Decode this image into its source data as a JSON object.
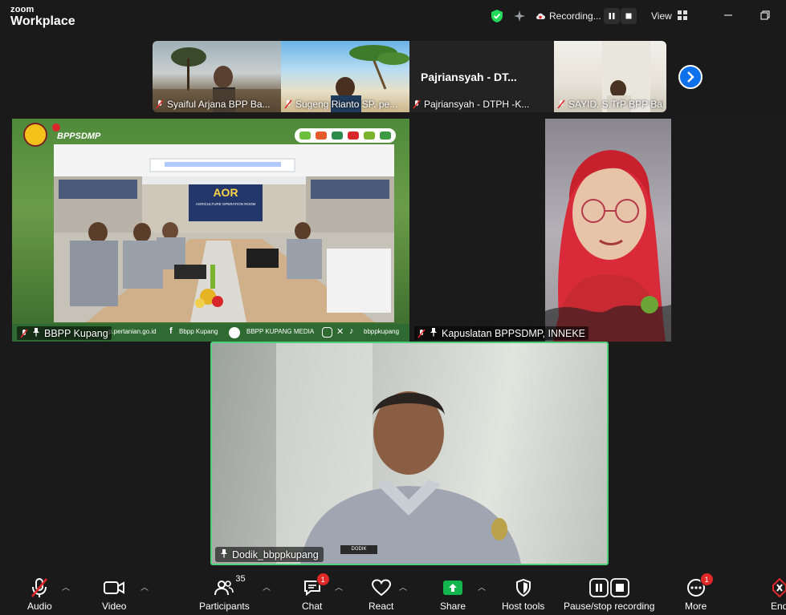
{
  "app": {
    "brand_small": "zoom",
    "brand_big": "Workplace"
  },
  "titlebar": {
    "recording_label": "Recording...",
    "view_label": "View"
  },
  "strip": [
    {
      "name": "Syaiful Arjana BPP Ba..."
    },
    {
      "name": "Sugeng Rianto SP. pe..."
    },
    {
      "name": "Pajriansyah - DTPH -K...",
      "card_title": "Pajriansyah - DT..."
    },
    {
      "name": "SAYID. S.TrP BPP Bab..."
    }
  ],
  "tiles": {
    "main_share": {
      "name": "BBPP Kupang",
      "logo_text": "BPPSDMP",
      "banner_title": "AOR",
      "banner_sub": "AGRICULTURE OPERATION ROOM",
      "footer_web": "p.pertanian.go.id",
      "footer_fb": "Bbpp Kupang",
      "footer_yt": "BBPP KUPANG MEDIA",
      "footer_ig": "bbppkupang"
    },
    "right": {
      "name": "Kapuslatan BPPSDMP, INNEKE"
    },
    "bottom": {
      "name": "Dodik_bbppkupang"
    }
  },
  "toolbar": {
    "audio": "Audio",
    "video": "Video",
    "participants": "Participants",
    "participants_count": "35",
    "chat": "Chat",
    "chat_badge": "1",
    "react": "React",
    "share": "Share",
    "host_tools": "Host tools",
    "pause_stop": "Pause/stop recording",
    "more": "More",
    "more_badge": "1",
    "end": "End"
  },
  "colors": {
    "accent_green": "#23d959",
    "share_green": "#11b44d",
    "badge_red": "#e02828",
    "blue": "#0e71eb",
    "speaker_border": "#4fd07a"
  }
}
